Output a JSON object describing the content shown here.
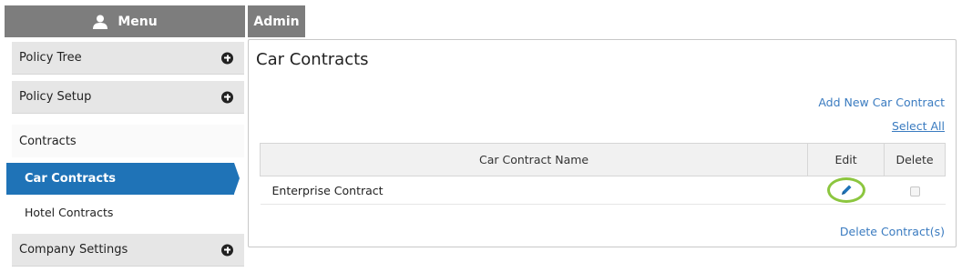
{
  "sidebar": {
    "menu_label": "Menu",
    "items": [
      {
        "label": "Policy Tree"
      },
      {
        "label": "Policy Setup"
      },
      {
        "label": "Contracts"
      },
      {
        "label": "Car Contracts"
      },
      {
        "label": "Hotel Contracts"
      },
      {
        "label": "Company Settings"
      }
    ],
    "active_color": "#1f73b7"
  },
  "header": {
    "admin_tab_label": "Admin"
  },
  "main": {
    "title": "Car Contracts",
    "add_link": "Add New Car Contract",
    "select_all_link": "Select All",
    "delete_link": "Delete Contract(s)",
    "table": {
      "columns": [
        "Car Contract Name",
        "Edit",
        "Delete"
      ],
      "rows": [
        {
          "name": "Enterprise Contract"
        }
      ]
    }
  },
  "icons": {
    "menu": "user-icon",
    "expand": "plus-circle-icon",
    "edit": "pencil-icon"
  },
  "colors": {
    "link": "#3a7bc0",
    "highlight_circle": "#8cc63f",
    "header_gray": "#7d7d7d"
  }
}
